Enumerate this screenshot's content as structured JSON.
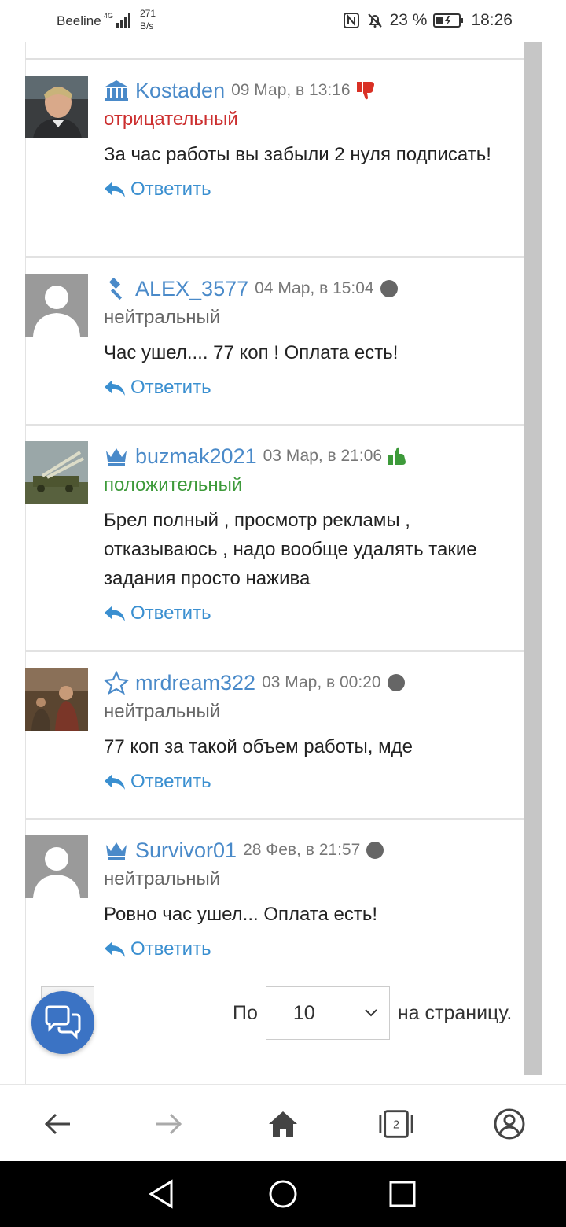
{
  "status_bar": {
    "carrier": "Beeline",
    "network": "4G",
    "speed_value": "271",
    "speed_unit": "B/s",
    "battery": "23 %",
    "time": "18:26"
  },
  "comments": [
    {
      "username": "Kostaden",
      "date": "09 Мар, в 13:16",
      "rating": "отрицательный",
      "text": "За час работы вы забыли 2 нуля подписать!",
      "reply": "Ответить"
    },
    {
      "username": "ALEX_3577",
      "date": "04 Мар, в 15:04",
      "rating": "нейтральный",
      "text": "Час ушел.... 77 коп ! Оплата есть!",
      "reply": "Ответить"
    },
    {
      "username": "buzmak2021",
      "date": "03 Мар, в 21:06",
      "rating": "положительный",
      "text": "Брел полный , просмотр рекламы , отказываюсь , надо вообще удалять такие задания просто нажива",
      "reply": "Ответить"
    },
    {
      "username": "mrdream322",
      "date": "03 Мар, в 00:20",
      "rating": "нейтральный",
      "text": "77 коп за такой объем работы, мде",
      "reply": "Ответить"
    },
    {
      "username": "Survivor01",
      "date": "28 Фев, в 21:57",
      "rating": "нейтральный",
      "text": "Ровно час ушел... Оплата есть!",
      "reply": "Ответить"
    }
  ],
  "pagination": {
    "prefix": "По",
    "selected": "10",
    "suffix": "на страницу."
  },
  "browser": {
    "tab_count": "2"
  },
  "colors": {
    "link": "#4a8ac9",
    "negative": "#cc2f2f",
    "positive": "#3d9a3a",
    "neutral": "#666666",
    "fab": "#3b73c4"
  }
}
